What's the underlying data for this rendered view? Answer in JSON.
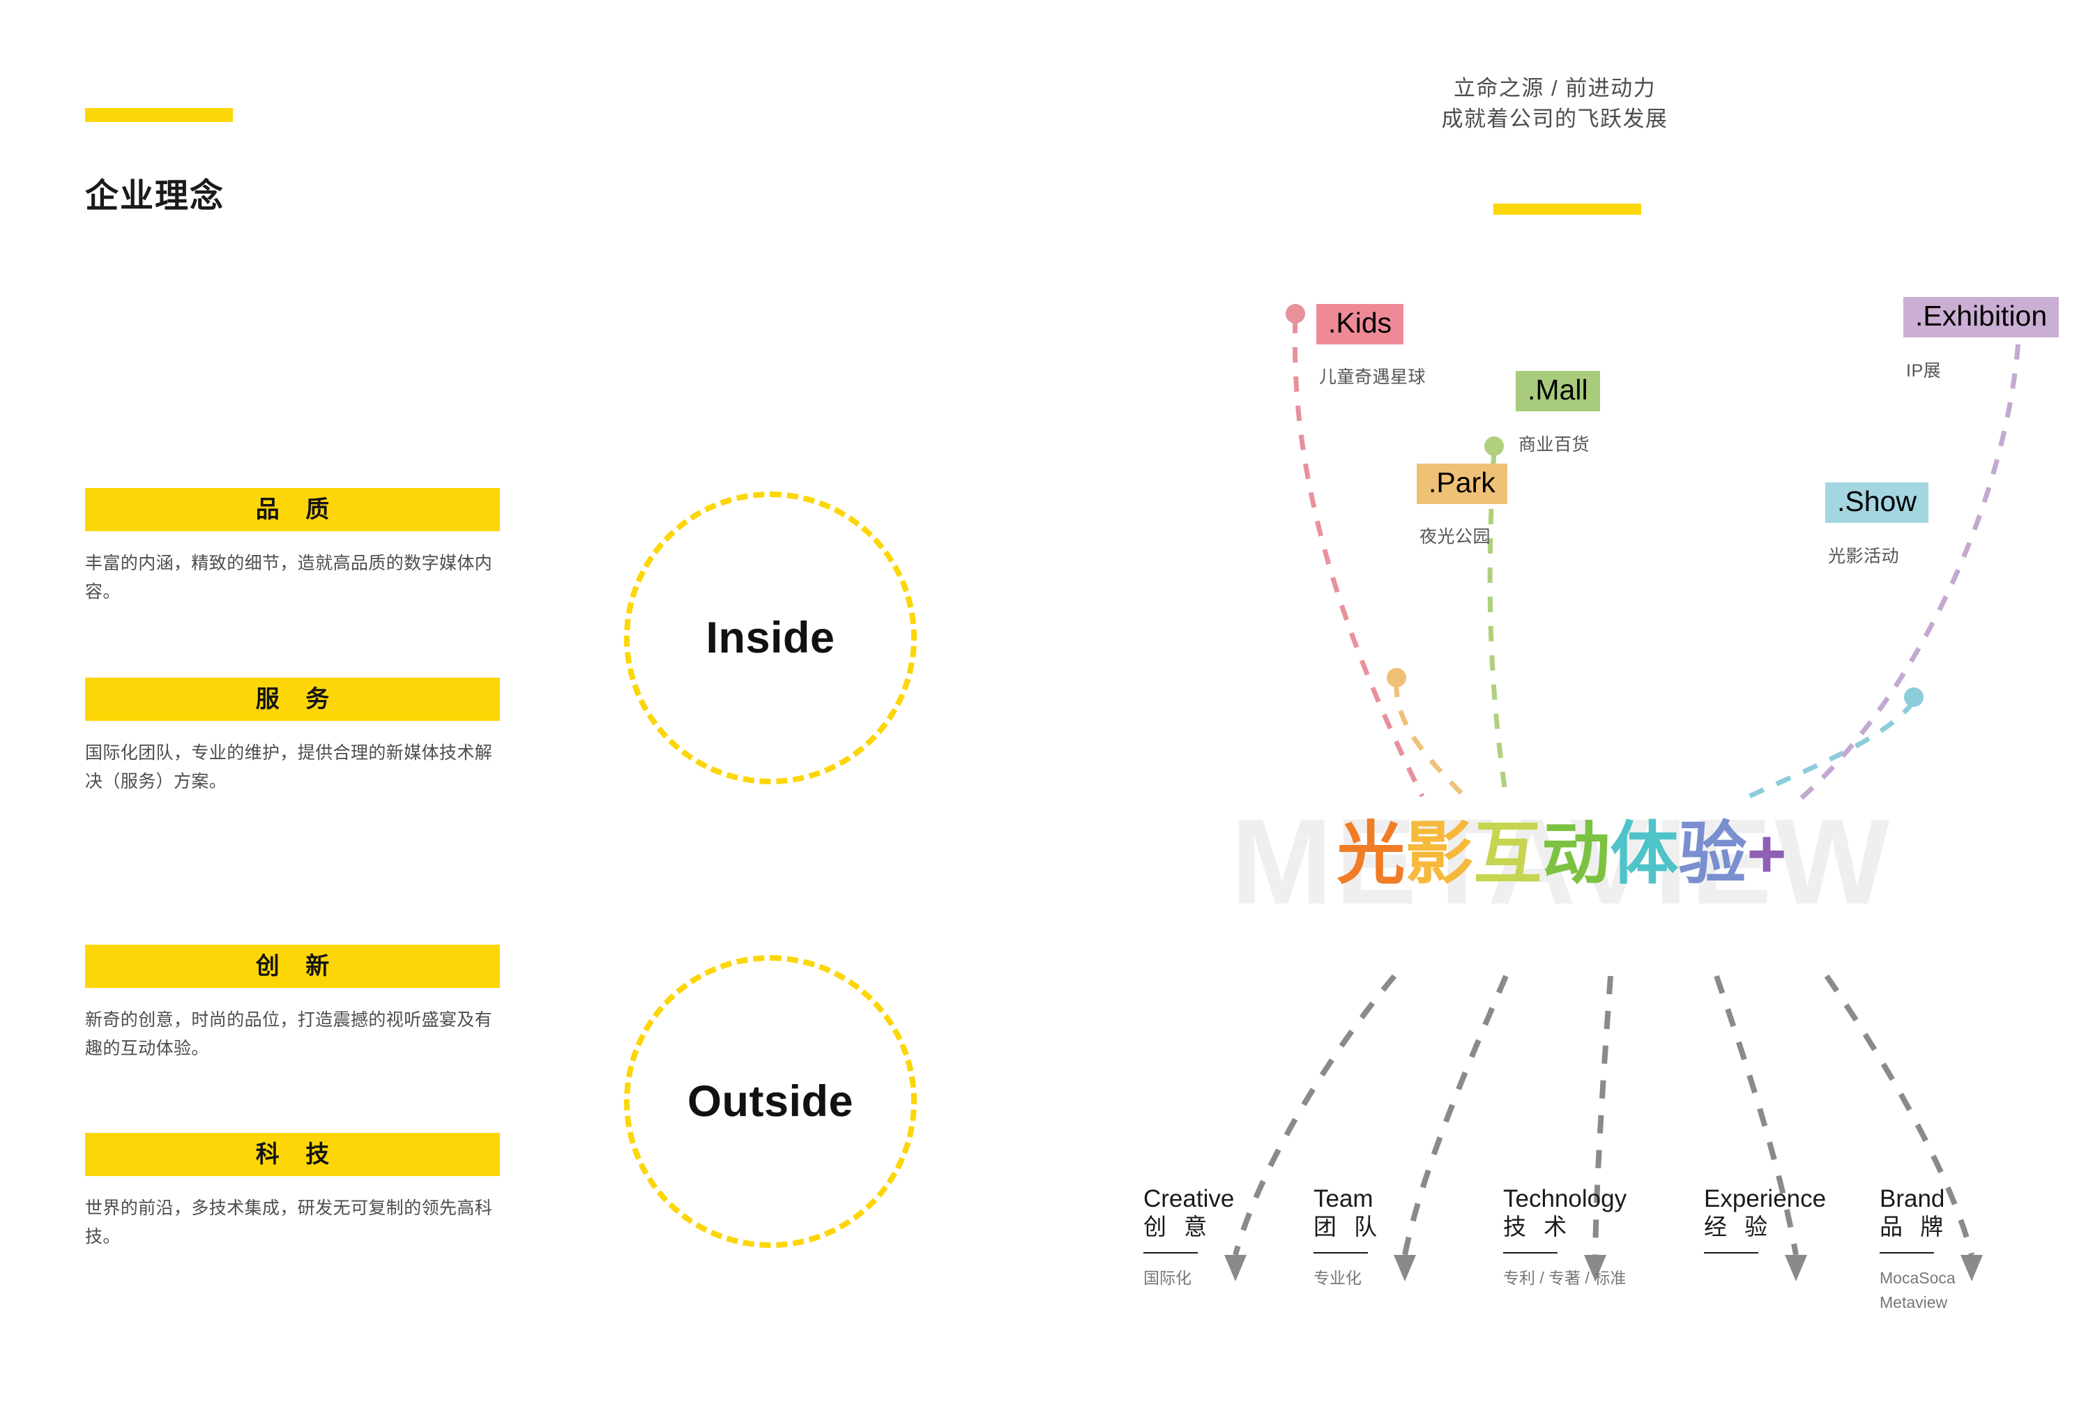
{
  "page": {
    "title": "企业理念",
    "accent_yellow": "#FCD607"
  },
  "header": {
    "line1": "立命之源 / 前进动力",
    "line2": "成就着公司的飞跃发展"
  },
  "values": [
    {
      "heading": "品  质",
      "body": "丰富的内涵，精致的细节，造就高品质的数字媒体内容。"
    },
    {
      "heading": "服  务",
      "body": "国际化团队，专业的维护，提供合理的新媒体技术解决（服务）方案。"
    },
    {
      "heading": "创  新",
      "body": "新奇的创意，时尚的品位，打造震撼的视听盛宴及有趣的互动体验。"
    },
    {
      "heading": "科  技",
      "body": "世界的前沿，多技术集成，研发无可复制的领先高科技。"
    }
  ],
  "circles": {
    "inside": "Inside",
    "outside": "Outside"
  },
  "segments": [
    {
      "tag": ".Kids",
      "sub": "儿童奇遇星球",
      "color": "#EE8A96"
    },
    {
      "tag": ".Park",
      "sub": "夜光公园",
      "color": "#EFC177"
    },
    {
      "tag": ".Mall",
      "sub": "商业百货",
      "color": "#A8CC7C"
    },
    {
      "tag": ".Show",
      "sub": "光影活动",
      "color": "#A3D6E0"
    },
    {
      "tag": ".Exhibition",
      "sub": "IP展",
      "color": "#CBAED4"
    }
  ],
  "logo": {
    "watermark": "METAVIEW",
    "chars": [
      {
        "ch": "光",
        "color": "#F07C26"
      },
      {
        "ch": "影",
        "color": "#F6B93B"
      },
      {
        "ch": "互",
        "color": "#C6D44F"
      },
      {
        "ch": "动",
        "color": "#7CC242"
      },
      {
        "ch": "体",
        "color": "#4EC3C9"
      },
      {
        "ch": "验",
        "color": "#7A8FD0"
      },
      {
        "ch": "+",
        "color": "#8E5FB5"
      }
    ]
  },
  "pillars": [
    {
      "en": "Creative",
      "cn": "创 意",
      "note": "国际化"
    },
    {
      "en": "Team",
      "cn": "团 队",
      "note": "专业化"
    },
    {
      "en": "Technology",
      "cn": "技 术",
      "note": "专利 / 专著 / 标准"
    },
    {
      "en": "Experience",
      "cn": "经 验",
      "note": ""
    },
    {
      "en": "Brand",
      "cn": "品 牌",
      "note": "MocaSoca\nMetaview"
    }
  ]
}
